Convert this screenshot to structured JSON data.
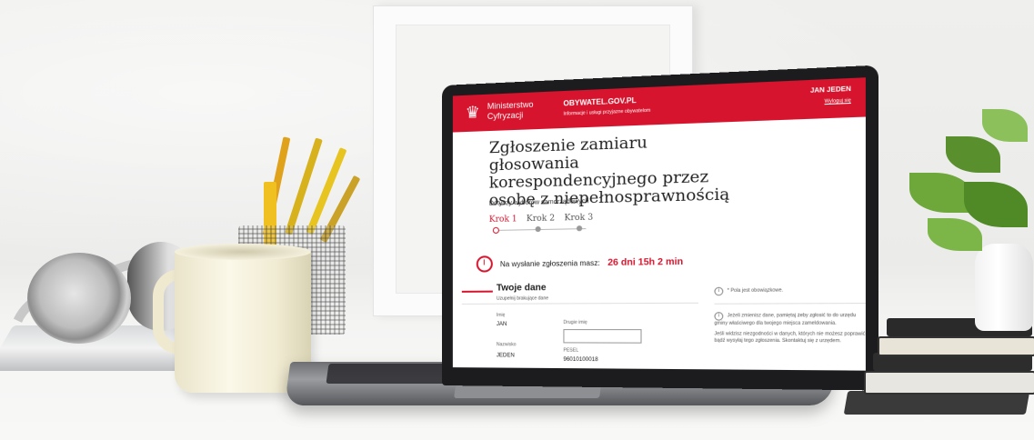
{
  "header": {
    "ministry_line1": "Ministerstwo",
    "ministry_line2": "Cyfryzacji",
    "portal_name": "OBYWATEL.GOV.PL",
    "portal_subtitle": "Informacje i usługi przyjazne obywatelom",
    "user_name": "JAN JEDEN",
    "user_link": "Wyloguj się"
  },
  "form": {
    "title": "Zgłoszenie zamiaru głosowania korespondencyjnego przez osobę z niepełnosprawnością",
    "subtitle": "Dotyczy wyborów samorządowych",
    "steps": [
      "Krok 1",
      "Krok 2",
      "Krok 3"
    ],
    "timer_label": "Na wysłanie zgłoszenia masz:",
    "timer_value": "26 dni 15h 2 min"
  },
  "section": {
    "title": "Twoje dane",
    "subtitle": "Uzupełnij brakujące dane",
    "fields": {
      "first_name_label": "Imię",
      "first_name_value": "JAN",
      "second_name_label": "Drugie imię",
      "last_name_label": "Nazwisko",
      "last_name_value": "JEDEN",
      "pesel_label": "PESEL",
      "pesel_value": "96010100018"
    }
  },
  "side_panel": {
    "required_note": "* Pola jest obowiązkowe.",
    "info_text": "Jeżeli zmienisz dane, pamiętaj żeby zgłosić to do urzędu gminy właściwego dla twojego miejsca zameldowania.",
    "info_text2": "Jeśli widzisz niezgodności w danych, których nie możesz poprawić, bądź wysyłaj tego zgłoszenia. Skontaktuj się z urzędem."
  },
  "colors": {
    "brand_red": "#d6142d"
  },
  "icons": [
    "emblem-icon",
    "clock-icon",
    "info-icon"
  ]
}
